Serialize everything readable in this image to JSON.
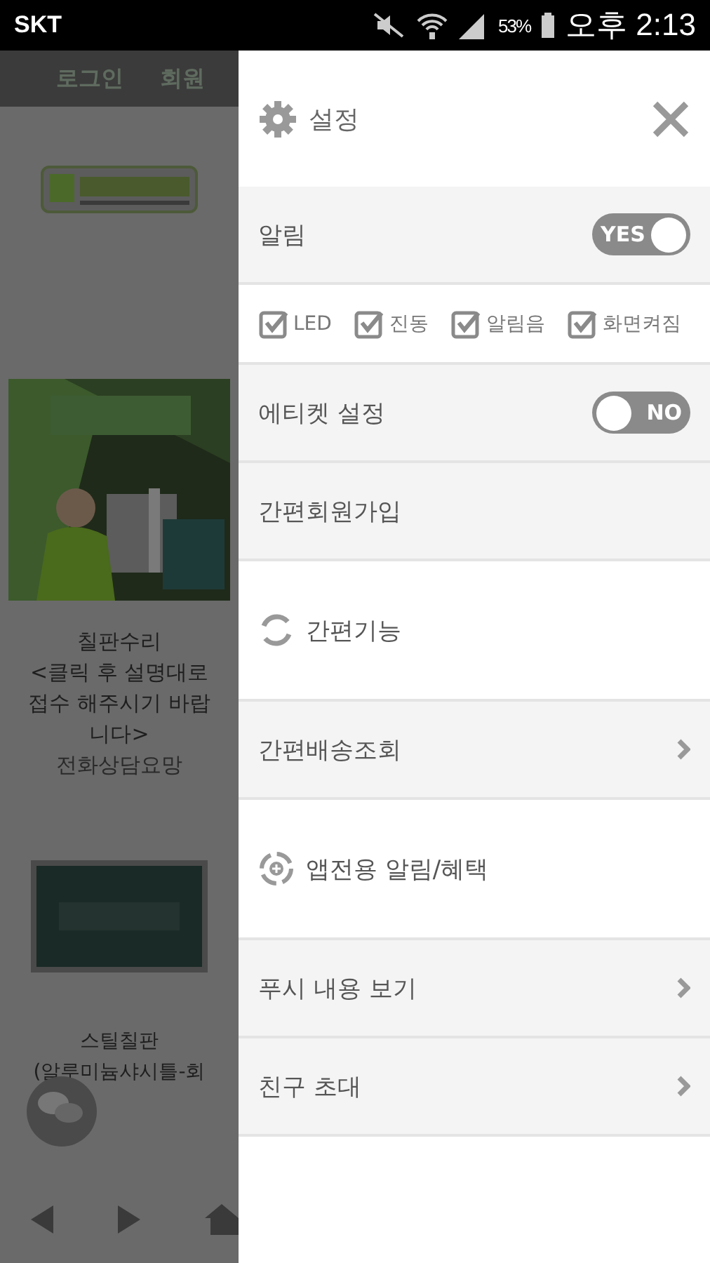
{
  "status_bar": {
    "carrier": "SKT",
    "battery": "53%",
    "time": "오후 2:13"
  },
  "background_page": {
    "header_links": [
      "로그인",
      "회원"
    ],
    "product": {
      "title": "칠판수리",
      "description": "<클릭 후 설명대로 접수 해주시기 바랍니다>",
      "note": "전화상담요망"
    },
    "product_2": {
      "title": "스틸칠판",
      "subtitle": "(알루미늄샤시틀-회"
    }
  },
  "drawer": {
    "title": "설정",
    "rows": [
      {
        "kind": "toggle",
        "label": "알림",
        "on": true,
        "switch_text": "YES"
      },
      {
        "kind": "checks",
        "items": [
          {
            "label": "LED",
            "checked": true
          },
          {
            "label": "진동",
            "checked": true
          },
          {
            "label": "알림음",
            "checked": true
          },
          {
            "label": "화면켜짐",
            "checked": true
          }
        ]
      },
      {
        "kind": "toggle",
        "label": "에티켓 설정",
        "on": false,
        "switch_text": "NO"
      },
      {
        "kind": "link",
        "label": "간편회원가입",
        "arrow": false
      },
      {
        "kind": "sync_section",
        "label": "간편기능"
      },
      {
        "kind": "link",
        "label": "간편배송조회",
        "arrow": true
      },
      {
        "kind": "promo_section",
        "label": "앱전용 알림/혜택"
      },
      {
        "kind": "link",
        "label": "푸시 내용 보기",
        "arrow": true
      },
      {
        "kind": "link",
        "label": "친구 초대",
        "arrow": true
      }
    ]
  }
}
